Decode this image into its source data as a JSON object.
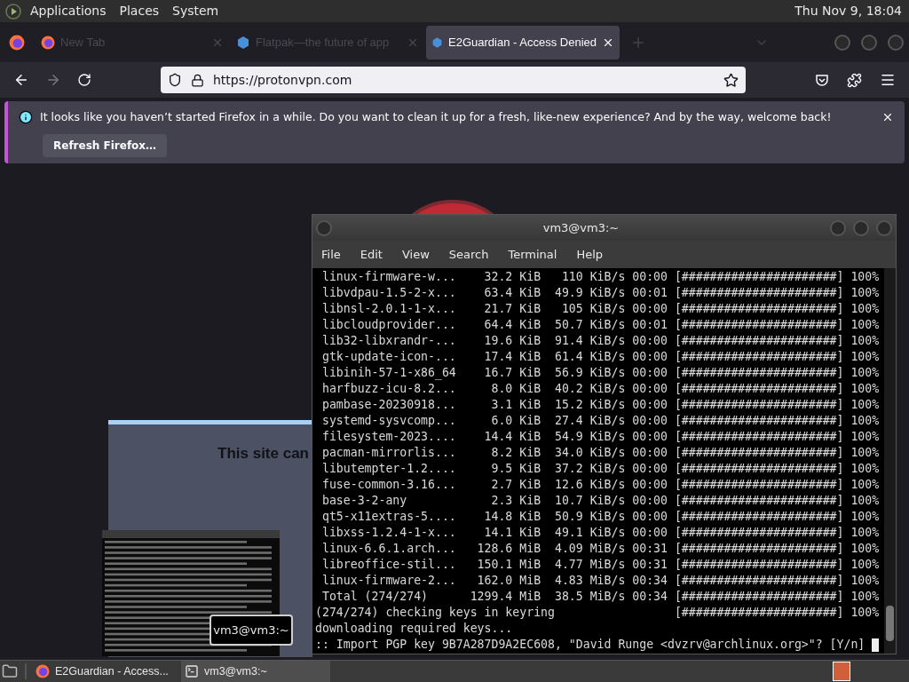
{
  "top_panel": {
    "menus": [
      "Applications",
      "Places",
      "System"
    ],
    "clock": "Thu Nov 9, 18:04"
  },
  "browser": {
    "tabs": [
      {
        "title": "New Tab",
        "selected": false
      },
      {
        "title": "Flatpak—the future of app",
        "selected": false
      },
      {
        "title": "E2Guardian - Access Denied",
        "selected": true
      }
    ],
    "url": "https://protonvpn.com",
    "notification": {
      "message": "It looks like you haven’t started Firefox in a while. Do you want to clean it up for a fresh, like-new experience? And by the way, welcome back!",
      "button": "Refresh Firefox…"
    },
    "page": {
      "heading": "This site can"
    }
  },
  "terminal": {
    "title": "vm3@vm3:~",
    "menu": [
      "File",
      "Edit",
      "View",
      "Search",
      "Terminal",
      "Help"
    ],
    "lines": [
      " linux-firmware-w...    32.2 KiB   110 KiB/s 00:00 [######################] 100%",
      " libvdpau-1.5-2-x...    63.4 KiB  49.9 KiB/s 00:01 [######################] 100%",
      " libnsl-2.0.1-1-x...    21.7 KiB   105 KiB/s 00:00 [######################] 100%",
      " libcloudprovider...    64.4 KiB  50.7 KiB/s 00:01 [######################] 100%",
      " lib32-libxrandr-...    19.6 KiB  91.4 KiB/s 00:00 [######################] 100%",
      " gtk-update-icon-...    17.4 KiB  61.4 KiB/s 00:00 [######################] 100%",
      " libinih-57-1-x86_64    16.7 KiB  56.9 KiB/s 00:00 [######################] 100%",
      " harfbuzz-icu-8.2...     8.0 KiB  40.2 KiB/s 00:00 [######################] 100%",
      " pambase-20230918...     3.1 KiB  15.2 KiB/s 00:00 [######################] 100%",
      " systemd-sysvcomp...     6.0 KiB  27.4 KiB/s 00:00 [######################] 100%",
      " filesystem-2023....    14.4 KiB  54.9 KiB/s 00:00 [######################] 100%",
      " pacman-mirrorlis...     8.2 KiB  34.0 KiB/s 00:00 [######################] 100%",
      " libutempter-1.2....     9.5 KiB  37.2 KiB/s 00:00 [######################] 100%",
      " fuse-common-3.16...     2.7 KiB  12.6 KiB/s 00:00 [######################] 100%",
      " base-3-2-any            2.3 KiB  10.7 KiB/s 00:00 [######################] 100%",
      " qt5-x11extras-5....    14.8 KiB  50.9 KiB/s 00:00 [######################] 100%",
      " libxss-1.2.4-1-x...    14.1 KiB  49.1 KiB/s 00:00 [######################] 100%",
      " linux-6.6.1.arch...   128.6 MiB  4.09 MiB/s 00:31 [######################] 100%",
      " libreoffice-stil...   150.1 MiB  4.77 MiB/s 00:31 [######################] 100%",
      " linux-firmware-2...   162.0 MiB  4.83 MiB/s 00:34 [######################] 100%",
      " Total (274/274)      1299.4 MiB  38.5 MiB/s 00:34 [######################] 100%",
      "(274/274) checking keys in keyring                 [######################] 100%",
      "downloading required keys...",
      ":: Import PGP key 9B7A287D9A2EC608, \"David Runge <dvzrv@archlinux.org>\"? [Y/n]"
    ]
  },
  "tooltip": "vm3@vm3:~",
  "taskbar": [
    {
      "title": "E2Guardian - Access...",
      "kind": "browser",
      "selected": false
    },
    {
      "title": "vm3@vm3:~",
      "kind": "terminal",
      "selected": true
    }
  ]
}
